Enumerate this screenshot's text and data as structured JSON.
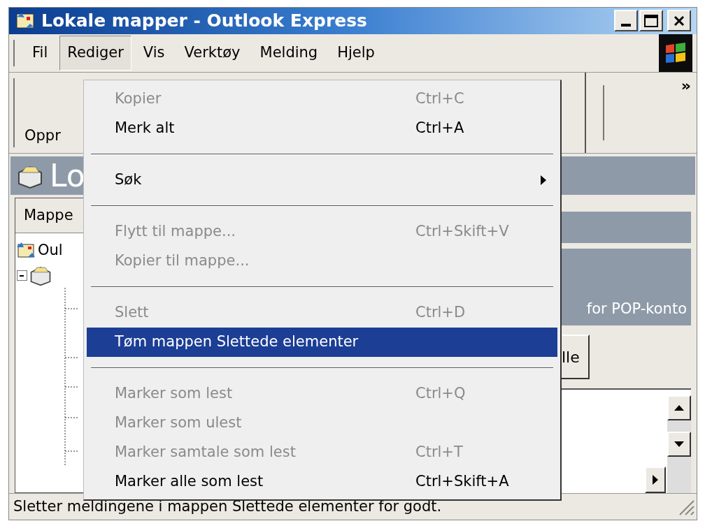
{
  "window": {
    "title": "Lokale mapper - Outlook Express"
  },
  "menu_bar": [
    {
      "label": "Fil",
      "selected": false
    },
    {
      "label": "Rediger",
      "selected": true
    },
    {
      "label": "Vis",
      "selected": false
    },
    {
      "label": "Verktøy",
      "selected": false
    },
    {
      "label": "Melding",
      "selected": false
    },
    {
      "label": "Hjelp",
      "selected": false
    }
  ],
  "toolbar": {
    "button_label": "Oppr",
    "overflow": "»"
  },
  "header": {
    "title": "Lo"
  },
  "folder_pane": {
    "heading": "Mappe",
    "tree": [
      {
        "label": "Oul",
        "children": [
          {
            "expanded": true
          }
        ]
      }
    ]
  },
  "content": {
    "banner_text": "for POP-konto",
    "button_label": "lle"
  },
  "edit_menu": [
    {
      "kind": "item",
      "label": "Kopier",
      "shortcut": "Ctrl+C",
      "disabled": true,
      "selected": false
    },
    {
      "kind": "item",
      "label": "Merk alt",
      "shortcut": "Ctrl+A",
      "disabled": false,
      "selected": false
    },
    {
      "kind": "separator"
    },
    {
      "kind": "submenu",
      "label": "Søk",
      "disabled": false,
      "selected": false
    },
    {
      "kind": "separator"
    },
    {
      "kind": "item",
      "label": "Flytt til mappe...",
      "shortcut": "Ctrl+Skift+V",
      "disabled": true,
      "selected": false
    },
    {
      "kind": "item",
      "label": "Kopier til mappe...",
      "disabled": true,
      "selected": false
    },
    {
      "kind": "separator"
    },
    {
      "kind": "item",
      "label": "Slett",
      "shortcut": "Ctrl+D",
      "disabled": true,
      "selected": false
    },
    {
      "kind": "item",
      "label": "Tøm mappen Slettede elementer",
      "disabled": false,
      "selected": true
    },
    {
      "kind": "separator"
    },
    {
      "kind": "item",
      "label": "Marker som lest",
      "shortcut": "Ctrl+Q",
      "disabled": true,
      "selected": false
    },
    {
      "kind": "item",
      "label": "Marker som ulest",
      "disabled": true,
      "selected": false
    },
    {
      "kind": "item",
      "label": "Marker samtale som lest",
      "shortcut": "Ctrl+T",
      "disabled": true,
      "selected": false
    },
    {
      "kind": "item",
      "label": "Marker alle som lest",
      "shortcut": "Ctrl+Skift+A",
      "disabled": false,
      "selected": false
    }
  ],
  "status_bar": {
    "text": "Sletter meldingene i mappen Slettede elementer for godt."
  }
}
